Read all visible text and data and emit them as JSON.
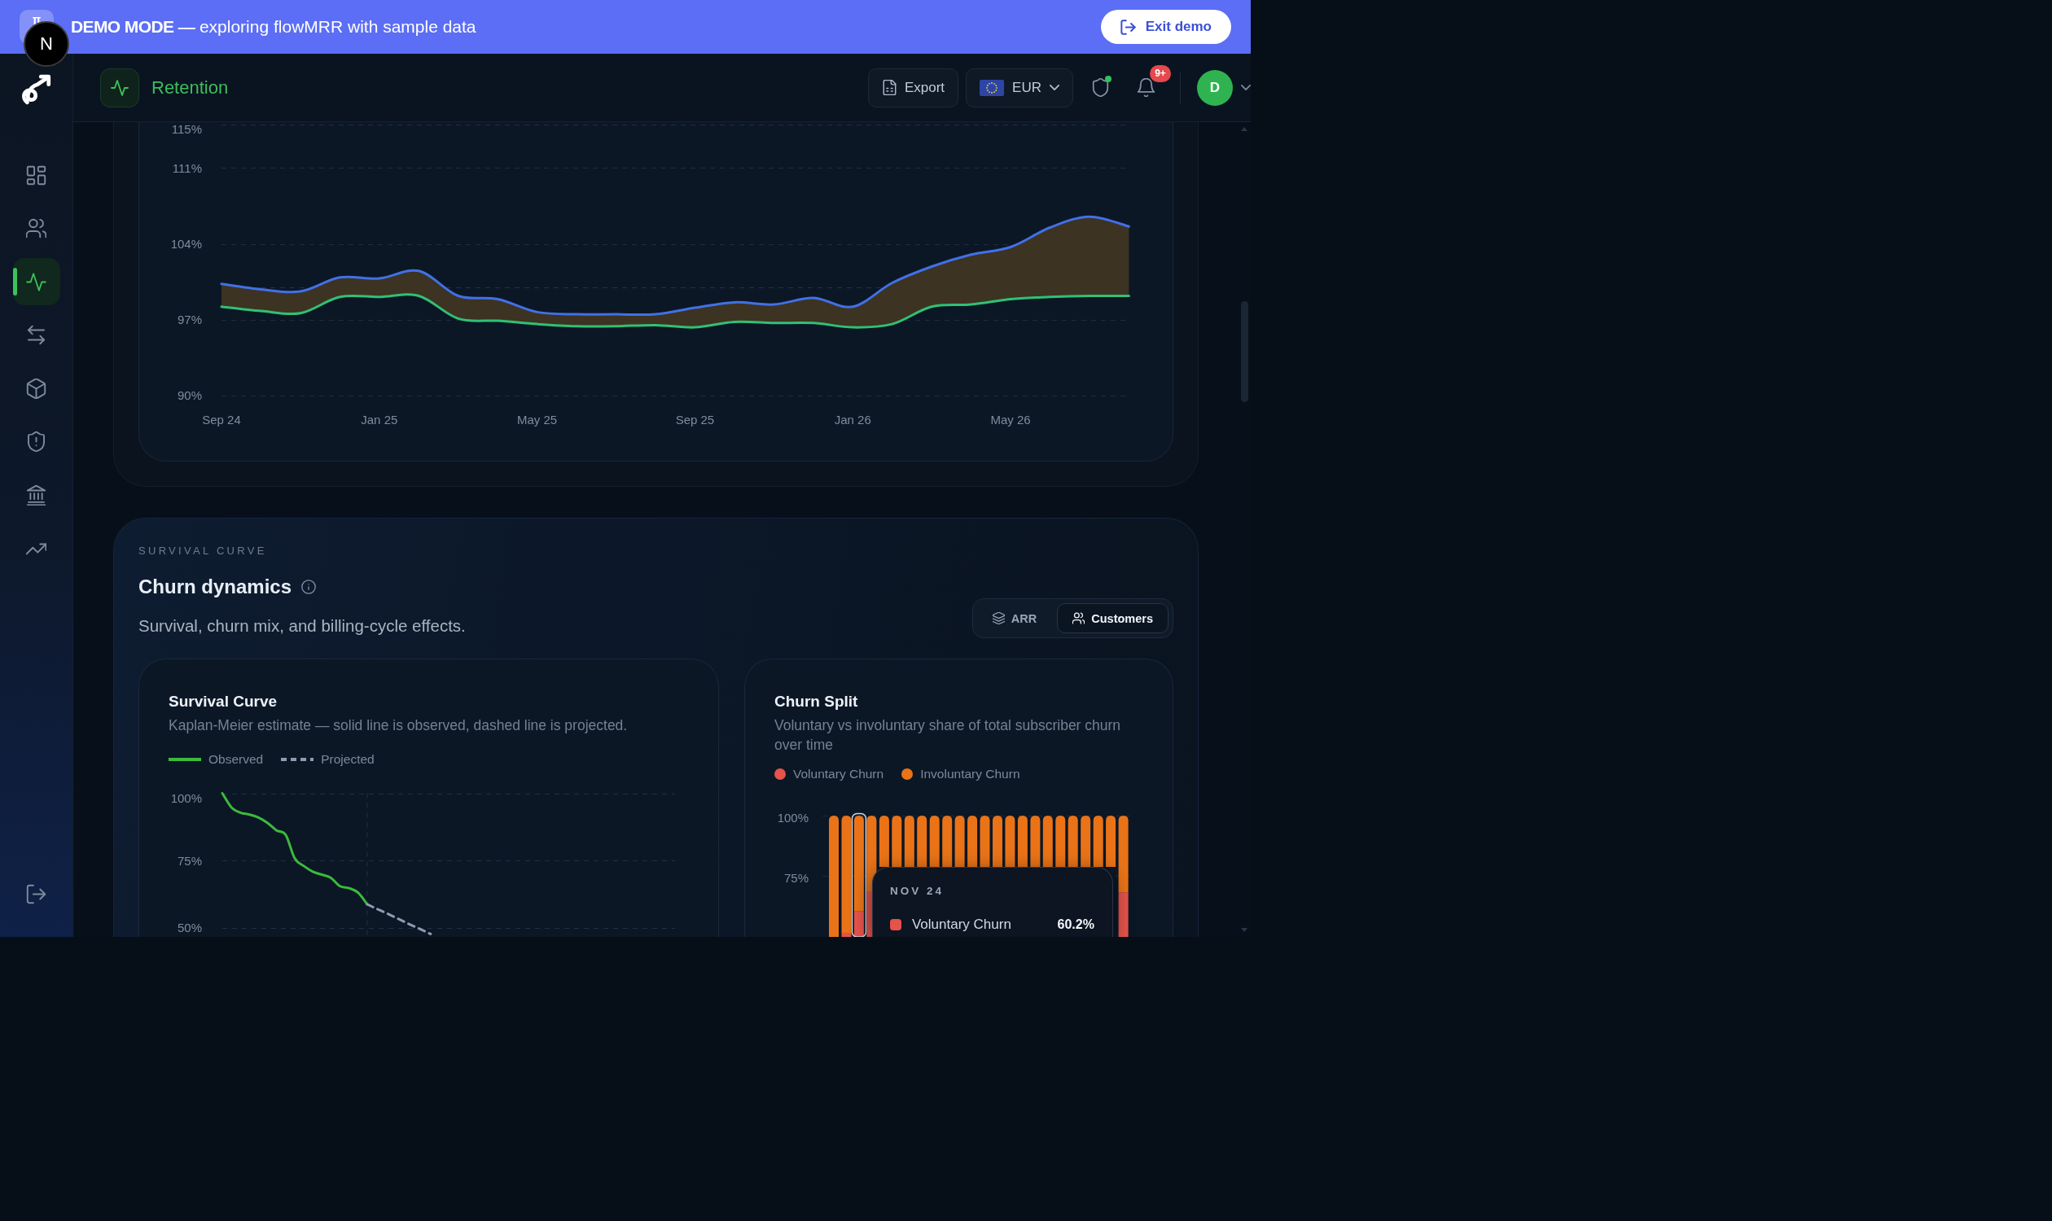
{
  "banner": {
    "message": "**DEMO MODE —** exploring flowMRR with sample data",
    "button": "Exit demo"
  },
  "dev_badge": {
    "label": "N"
  },
  "sidebar": {
    "items": [
      {
        "kind": "grid",
        "selected": false
      },
      {
        "kind": "users",
        "selected": false
      },
      {
        "kind": "pulse",
        "selected": true
      },
      {
        "kind": "arrows",
        "selected": false
      },
      {
        "kind": "cube",
        "selected": false
      },
      {
        "kind": "shield",
        "selected": false
      },
      {
        "kind": "bank",
        "selected": false
      },
      {
        "kind": "trend",
        "selected": false
      }
    ],
    "footer_items": [
      {
        "kind": "logout"
      }
    ]
  },
  "header": {
    "title": "Retention",
    "export_button": "Export",
    "currency": "EUR",
    "status_dot": true,
    "notifications_badge": "9+",
    "avatar": "D"
  },
  "retention_chart": {
    "chart_data": {
      "type": "line",
      "grid": true,
      "categories": [
        "Sep 24",
        null,
        null,
        null,
        "Jan 25",
        null,
        null,
        null,
        "May 25",
        null,
        null,
        null,
        "Sep 25",
        null,
        null,
        null,
        "Jan 26",
        null,
        null,
        null,
        "May 26",
        null,
        null,
        null
      ],
      "ylim": [
        90,
        115
      ],
      "yticks": [
        {
          "value": 90,
          "label": "90%"
        },
        {
          "value": 97,
          "label": "97%"
        },
        {
          "value": 104,
          "label": "104%"
        },
        {
          "value": 111,
          "label": "111%"
        },
        {
          "value": 115,
          "label": "115%"
        }
      ],
      "series": [
        {
          "type": "area",
          "color": "#4170e8",
          "values": [
            100.3,
            99.8,
            99.6,
            100.9,
            100.8,
            101.5,
            99.2,
            98.9,
            97.7,
            97.5,
            97.5,
            97.5,
            98.1,
            98.6,
            98.4,
            99.0,
            98.2,
            100.4,
            101.9,
            103.0,
            103.7,
            105.5,
            106.5,
            105.6
          ]
        },
        {
          "type": "line",
          "color": "#30c174",
          "values": [
            98.2,
            97.8,
            97.6,
            99.1,
            99.1,
            99.2,
            97.1,
            96.9,
            96.6,
            96.4,
            96.4,
            96.5,
            96.3,
            96.8,
            96.7,
            96.7,
            96.3,
            96.6,
            98.2,
            98.4,
            98.9,
            99.1,
            99.2,
            99.2
          ]
        }
      ],
      "ref_lines": [
        {
          "axis": "y",
          "value": 100
        }
      ]
    }
  },
  "churn_dynamics": {
    "eyebrow": "SURVIVAL CURVE",
    "title": "Churn dynamics",
    "subtitle": "Survival, churn mix, and billing-cycle effects.",
    "toggle": [
      {
        "label": "ARR",
        "kind": "layers",
        "selected": false
      },
      {
        "label": "Customers",
        "kind": "users",
        "selected": true
      }
    ],
    "survival": {
      "title": "Survival Curve",
      "subtitle": "Kaplan-Meier estimate — solid line is observed, dashed line is projected.",
      "chart_data": {
        "type": "line",
        "grid": true,
        "categories": [
          null,
          null,
          null,
          null,
          null,
          null,
          null,
          null,
          null,
          null,
          null,
          null,
          null,
          null,
          null,
          null,
          null,
          null,
          null,
          null,
          null,
          null,
          null,
          null,
          null,
          null,
          null,
          null,
          null,
          null,
          null,
          null,
          null,
          null,
          null,
          null,
          null,
          null,
          null,
          null,
          null,
          null,
          null,
          null,
          null,
          null,
          null,
          null,
          null,
          null,
          null
        ],
        "ylim": [
          46.7,
          100
        ],
        "yticks": [
          {
            "value": 100,
            "label": "100%"
          },
          {
            "value": 75,
            "label": "75%"
          },
          {
            "value": 50,
            "label": "50%"
          }
        ],
        "series": [
          {
            "name": "Observed",
            "color": "#3cba3c",
            "line_style": "solid",
            "values": [
              100,
              94.8,
              92.8,
              92.1,
              91.0,
              89.0,
              86.2,
              84.6,
              75.8,
              73.0,
              70.9,
              69.8,
              68.6,
              65.5,
              64.8,
              63.1,
              58.8,
              null,
              null,
              null,
              null,
              null,
              null,
              null,
              null,
              null,
              null,
              null,
              null,
              null,
              null,
              null,
              null,
              null,
              null,
              null,
              null,
              null,
              null,
              null,
              null,
              null,
              null,
              null,
              null,
              null,
              null,
              null,
              null,
              null,
              null
            ]
          },
          {
            "name": "Projected",
            "color": "#8f9bb0",
            "line_style": "dashed",
            "values": [
              null,
              null,
              null,
              null,
              null,
              null,
              null,
              null,
              null,
              null,
              null,
              null,
              null,
              null,
              null,
              null,
              58.8,
              57.2,
              55.7,
              54.1,
              52.5,
              50.9,
              49.4,
              47.8,
              null,
              null,
              null,
              null,
              null,
              null,
              null,
              null,
              null,
              null,
              null,
              null,
              null,
              null,
              null,
              null,
              null,
              null,
              null,
              null,
              null,
              null,
              null,
              null,
              null,
              null,
              null
            ]
          }
        ]
      }
    },
    "churn_split": {
      "title": "Churn Split",
      "subtitle": "Voluntary vs involuntary share of total subscriber churn over time",
      "legend": [
        {
          "label": "Voluntary Churn",
          "color": "#e5534b"
        },
        {
          "label": "Involuntary Churn",
          "color": "#ea7317"
        }
      ],
      "y_axis_labels": [
        "100%",
        "75%"
      ],
      "bars": [
        {
          "highlighted": false
        },
        {
          "highlighted": false
        },
        {
          "highlighted": true
        },
        {
          "highlighted": false
        },
        {
          "highlighted": false
        },
        {
          "highlighted": false
        },
        {
          "highlighted": false
        },
        {
          "highlighted": false
        },
        {
          "highlighted": false
        },
        {
          "highlighted": false
        },
        {
          "highlighted": false
        },
        {
          "highlighted": false
        },
        {
          "highlighted": false
        },
        {
          "highlighted": false
        },
        {
          "highlighted": false
        },
        {
          "highlighted": false
        },
        {
          "highlighted": false
        },
        {
          "highlighted": false
        },
        {
          "highlighted": false
        },
        {
          "highlighted": false
        },
        {
          "highlighted": false
        },
        {
          "highlighted": false
        },
        {
          "highlighted": false
        },
        {
          "highlighted": false
        }
      ],
      "tooltip": {
        "title": "NOV 24",
        "rows": [
          {
            "label": "Voluntary Churn",
            "value": "60.2%",
            "color": "#e5534b"
          }
        ]
      }
    }
  }
}
